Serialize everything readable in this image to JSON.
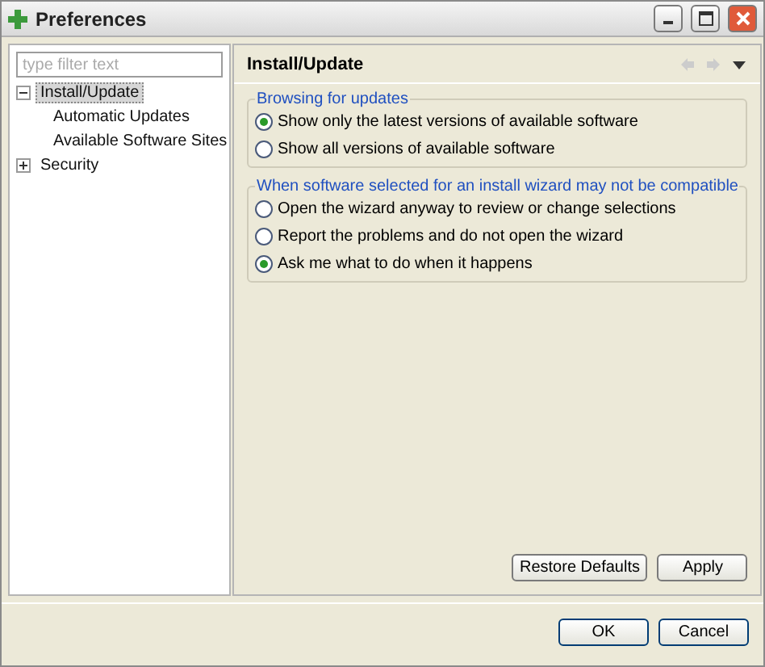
{
  "window": {
    "title": "Preferences"
  },
  "filter": {
    "placeholder": "type filter text"
  },
  "tree": [
    {
      "label": "Install/Update",
      "expanded": true,
      "selected": true,
      "children": [
        {
          "label": "Automatic Updates",
          "selected": false
        },
        {
          "label": "Available Software Sites",
          "selected": false
        }
      ]
    },
    {
      "label": "Security",
      "expanded": false,
      "selected": false
    }
  ],
  "page": {
    "title": "Install/Update",
    "groups": [
      {
        "title": "Browsing for updates",
        "options": [
          {
            "label": "Show only the latest versions of available software",
            "selected": true
          },
          {
            "label": "Show all versions of available software",
            "selected": false
          }
        ]
      },
      {
        "title": "When software selected for an install wizard may not be compatible",
        "options": [
          {
            "label": "Open the wizard anyway to review or change selections",
            "selected": false
          },
          {
            "label": "Report the problems and do not open the wizard",
            "selected": false
          },
          {
            "label": "Ask me what to do when it happens",
            "selected": true
          }
        ]
      }
    ],
    "buttons": [
      "Restore Defaults",
      "Apply"
    ]
  },
  "dialog_buttons": [
    "OK",
    "Cancel"
  ]
}
